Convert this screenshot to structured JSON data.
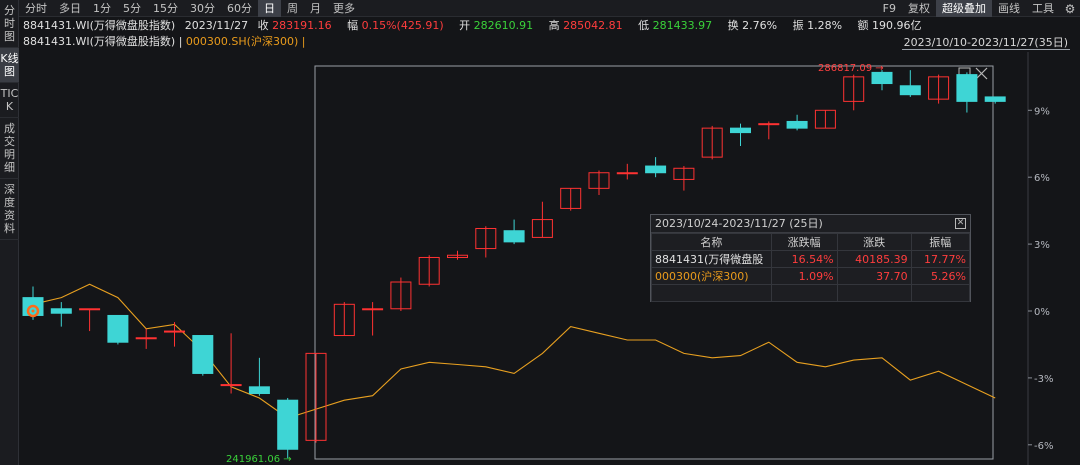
{
  "sidebar": {
    "items": [
      {
        "label": "分时图",
        "active": false
      },
      {
        "label": "K线图",
        "active": true
      },
      {
        "label": "TICK",
        "active": false
      },
      {
        "label": "成交明细",
        "active": false
      },
      {
        "label": "深度资料",
        "active": false
      }
    ]
  },
  "toolbar": {
    "periods": [
      {
        "label": "分时"
      },
      {
        "label": "多日"
      },
      {
        "label": "1分"
      },
      {
        "label": "5分"
      },
      {
        "label": "15分"
      },
      {
        "label": "30分"
      },
      {
        "label": "60分"
      },
      {
        "label": "日",
        "active": true
      },
      {
        "label": "周"
      },
      {
        "label": "月"
      },
      {
        "label": "更多"
      }
    ],
    "right": [
      {
        "label": "F9"
      },
      {
        "label": "复权"
      },
      {
        "label": "超级叠加",
        "active": true
      },
      {
        "label": "画线"
      },
      {
        "label": "工具"
      }
    ],
    "gear_icon": "gear-icon"
  },
  "quote": {
    "name": "8841431.WI(万得微盘股指数)",
    "date": "2023/11/27",
    "close_label": "收",
    "close": "283191.16",
    "change_label": "幅",
    "change": "0.15%(425.91)",
    "open_label": "开",
    "open": "282610.91",
    "high_label": "高",
    "high": "285042.81",
    "low_label": "低",
    "low": "281433.97",
    "turnover_label": "换",
    "turnover": "2.76%",
    "amplitude_label": "振",
    "amplitude": "1.28%",
    "amount_label": "额",
    "amount": "190.96亿"
  },
  "legend": {
    "main": "8841431.WI(万得微盘股指数)",
    "sep": "|",
    "overlay": "000300.SH(沪深300)",
    "sep2": "|"
  },
  "date_range": "2023/10/10-2023/11/27(35日)",
  "stats": {
    "title": "2023/10/24-2023/11/27 (25日)",
    "headers": [
      "名称",
      "涨跌幅",
      "涨跌",
      "振幅"
    ],
    "rows": [
      {
        "name": "8841431(万得微盘股",
        "pct": "16.54%",
        "chg": "40185.39",
        "amp": "17.77%"
      },
      {
        "name": "000300(沪深300)",
        "pct": "1.09%",
        "chg": "37.70",
        "amp": "5.26%"
      }
    ]
  },
  "chart_data": {
    "type": "candlestick",
    "colors": {
      "up": "#ff3232",
      "down": "#3ed5d5",
      "overlay": "#e8a020",
      "axis": "#8a8e96",
      "select": "#9a9ea6"
    },
    "yticks": [
      "9%",
      "6%",
      "3%",
      "0%",
      "-3%",
      "-6%"
    ],
    "ytick_values": [
      9,
      6,
      3,
      0,
      -3,
      -6
    ],
    "ylim": [
      -6.5,
      11.0
    ],
    "max_label": "286817.09",
    "min_label": "241961.06",
    "candles": [
      {
        "o": 0.6,
        "c": -0.2,
        "h": 1.1,
        "l": -0.4
      },
      {
        "o": 0.1,
        "c": -0.1,
        "h": 0.4,
        "l": -0.7
      },
      {
        "o": 0.1,
        "c": 0.1,
        "h": 0.1,
        "l": -0.9
      },
      {
        "o": -0.2,
        "c": -1.4,
        "h": -0.2,
        "l": -1.5
      },
      {
        "o": -1.2,
        "c": -1.2,
        "h": -0.8,
        "l": -1.7
      },
      {
        "o": -0.9,
        "c": -0.9,
        "h": -0.5,
        "l": -1.6
      },
      {
        "o": -1.1,
        "c": -2.8,
        "h": -1.1,
        "l": -2.9
      },
      {
        "o": -3.3,
        "c": -3.3,
        "h": -1.0,
        "l": -3.7
      },
      {
        "o": -3.4,
        "c": -3.7,
        "h": -2.1,
        "l": -3.8
      },
      {
        "o": -4.0,
        "c": -6.2,
        "h": -3.9,
        "l": -6.6
      },
      {
        "o": -5.8,
        "c": -1.9,
        "h": -1.9,
        "l": -5.9
      },
      {
        "o": -1.1,
        "c": 0.3,
        "h": 0.4,
        "l": -1.1
      },
      {
        "o": 0.1,
        "c": 0.1,
        "h": 0.4,
        "l": -1.1
      },
      {
        "o": 0.1,
        "c": 1.3,
        "h": 1.5,
        "l": 0.0
      },
      {
        "o": 1.2,
        "c": 2.4,
        "h": 2.5,
        "l": 1.1
      },
      {
        "o": 2.4,
        "c": 2.5,
        "h": 2.7,
        "l": 2.3
      },
      {
        "o": 2.8,
        "c": 3.7,
        "h": 3.8,
        "l": 2.4
      },
      {
        "o": 3.6,
        "c": 3.1,
        "h": 4.1,
        "l": 3.0
      },
      {
        "o": 3.3,
        "c": 4.1,
        "h": 4.9,
        "l": 3.3
      },
      {
        "o": 4.6,
        "c": 5.5,
        "h": 5.5,
        "l": 4.5
      },
      {
        "o": 5.5,
        "c": 6.2,
        "h": 6.3,
        "l": 5.2
      },
      {
        "o": 6.2,
        "c": 6.2,
        "h": 6.6,
        "l": 5.9
      },
      {
        "o": 6.5,
        "c": 6.2,
        "h": 6.9,
        "l": 6.0
      },
      {
        "o": 5.9,
        "c": 6.4,
        "h": 6.5,
        "l": 5.4
      },
      {
        "o": 6.9,
        "c": 8.2,
        "h": 8.3,
        "l": 6.8
      },
      {
        "o": 8.2,
        "c": 8.0,
        "h": 8.4,
        "l": 7.4
      },
      {
        "o": 8.4,
        "c": 8.4,
        "h": 8.5,
        "l": 7.7
      },
      {
        "o": 8.5,
        "c": 8.2,
        "h": 8.8,
        "l": 8.1
      },
      {
        "o": 8.2,
        "c": 9.0,
        "h": 9.0,
        "l": 8.2
      },
      {
        "o": 9.4,
        "c": 10.5,
        "h": 10.6,
        "l": 9.0
      },
      {
        "o": 10.7,
        "c": 10.2,
        "h": 10.8,
        "l": 9.9
      },
      {
        "o": 10.1,
        "c": 9.7,
        "h": 10.8,
        "l": 9.6
      },
      {
        "o": 9.5,
        "c": 10.5,
        "h": 10.6,
        "l": 9.3
      },
      {
        "o": 10.6,
        "c": 9.4,
        "h": 10.7,
        "l": 8.9
      },
      {
        "o": 9.6,
        "c": 9.4,
        "h": 9.6,
        "l": 9.3
      }
    ],
    "overlay": [
      0.3,
      0.6,
      1.2,
      0.6,
      -0.8,
      -0.6,
      -1.8,
      -3.4,
      -3.9,
      -4.8,
      -4.4,
      -4.0,
      -3.8,
      -2.6,
      -2.3,
      -2.4,
      -2.5,
      -2.8,
      -1.9,
      -0.7,
      -1.0,
      -1.3,
      -1.3,
      -1.9,
      -2.1,
      -2.0,
      -1.4,
      -2.3,
      -2.5,
      -2.2,
      -2.1,
      -3.1,
      -2.7,
      -3.3,
      -3.9
    ],
    "selection_range": [
      11,
      35
    ]
  }
}
